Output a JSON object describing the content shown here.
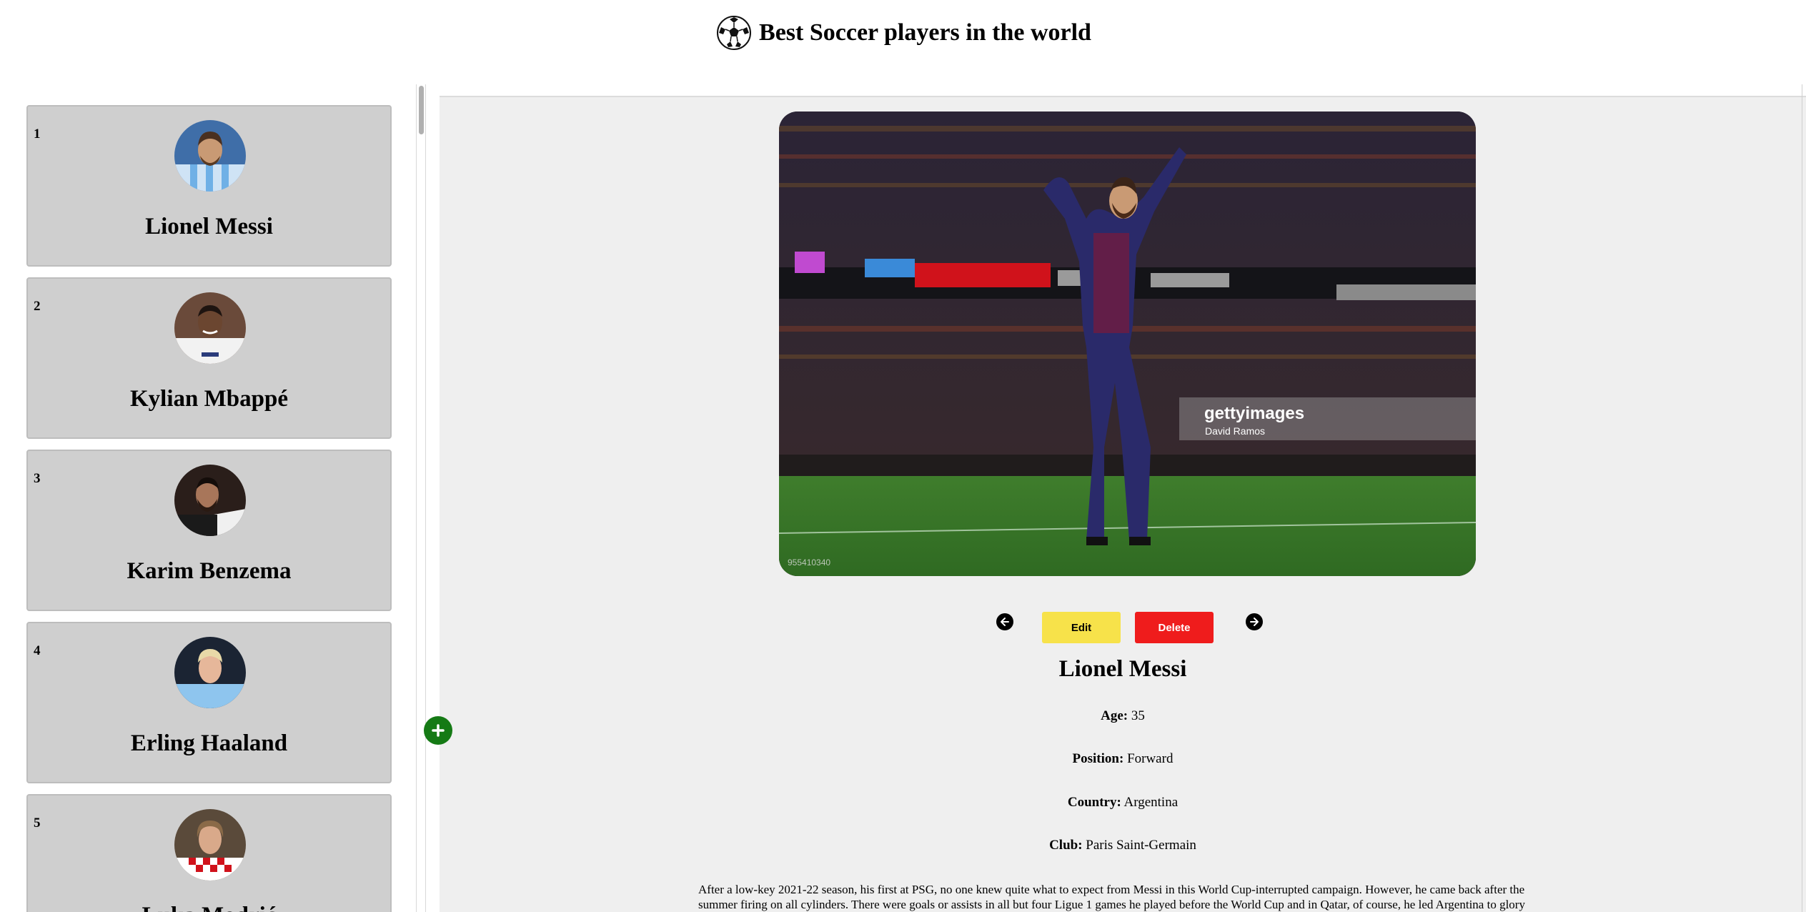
{
  "header": {
    "title": "Best Soccer players in the world"
  },
  "players": [
    {
      "rank": "1",
      "name": "Lionel Messi"
    },
    {
      "rank": "2",
      "name": "Kylian Mbappé"
    },
    {
      "rank": "3",
      "name": "Karim Benzema"
    },
    {
      "rank": "4",
      "name": "Erling Haaland"
    },
    {
      "rank": "5",
      "name": "Luka Modrić"
    }
  ],
  "detail": {
    "photo_watermark": "gettyimages",
    "photo_credit": "David Ramos",
    "photo_id": "955410340",
    "edit_label": "Edit",
    "delete_label": "Delete",
    "name": "Lionel Messi",
    "age_label": "Age:",
    "age": "35",
    "position_label": "Position:",
    "position": "Forward",
    "country_label": "Country:",
    "country": "Argentina",
    "club_label": "Club:",
    "club": "Paris Saint-Germain",
    "bio": "After a low-key 2021-22 season, his first at PSG, no one knew quite what to expect from Messi in this World Cup-interrupted campaign. However, he came back after the summer firing on all cylinders. There were goals or assists in all but four Ligue 1 games he played before the World Cup and in Qatar, of course, he led Argentina to glory"
  },
  "colors": {
    "card_bg": "#cfcfcf",
    "panel_bg": "#efefef",
    "edit": "#f7e24a",
    "delete": "#ef1c1c",
    "add": "#157a15"
  },
  "icons": {
    "logo": "soccer-ball-icon",
    "prev": "arrow-left-icon",
    "next": "arrow-right-icon",
    "add": "plus-icon"
  }
}
